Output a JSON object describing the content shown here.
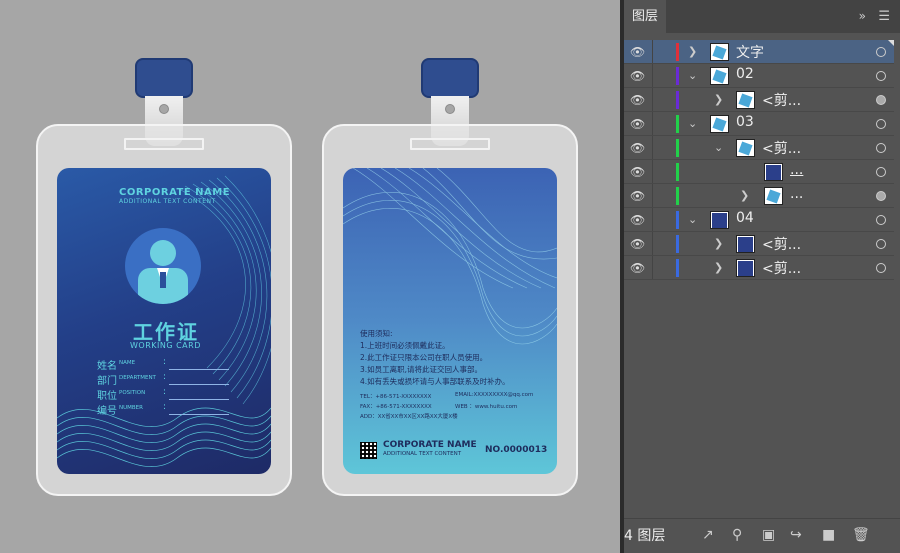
{
  "front_card": {
    "corp_name": "CORPORATE NAME",
    "corp_sub": "ADDITIONAL TEXT CONTENT",
    "title": "工作证",
    "title_en": "WORKING CARD",
    "fields": [
      {
        "cn": "姓名",
        "en": "NAME"
      },
      {
        "cn": "部门",
        "en": "DEPARTMENT"
      },
      {
        "cn": "职位",
        "en": "POSITION"
      },
      {
        "cn": "编号",
        "en": "NUMBER"
      }
    ],
    "colon": ":"
  },
  "back_card": {
    "notes_title": "使用须知:",
    "notes": [
      "1.上班时间必须佩戴此证。",
      "2.此工作证只限本公司在职人员使用。",
      "3.如员工离职,请将此证交回人事部。",
      "4.如有丢失或损坏请与人事部联系及时补办。"
    ],
    "tel": "TEL：+86-571-XXXXXXXX",
    "email": "EMAIL:XXXXXXXXX@qq.com",
    "fax": "FAX：+86-571-XXXXXXXX",
    "web": "WEB ：www.huitu.com",
    "add": "ADD：XX省XX市XX区XX路XX大厦X楼",
    "corp_name": "CORPORATE NAME",
    "corp_sub": "ADDITIONAL TEXT CONTENT",
    "number": "NO.0000013"
  },
  "layers_panel": {
    "tab": "图层",
    "collapse_icon": "double-chevron-icon",
    "menu_icon": "hamburger-icon",
    "count_label": "4 图层",
    "rows": [
      {
        "name": "文字",
        "color": "#e0303a"
      },
      {
        "name": "02",
        "color": "#6a2bd6"
      },
      {
        "name": "<剪...",
        "color": "#6a2bd6"
      },
      {
        "name": "03",
        "color": "#22d04a"
      },
      {
        "name": "<剪...",
        "color": "#22d04a"
      },
      {
        "name": "...",
        "color": "#22d04a"
      },
      {
        "name": "...",
        "color": "#22d04a"
      },
      {
        "name": "04",
        "color": "#3a6ae0"
      },
      {
        "name": "<剪...",
        "color": "#3a6ae0"
      },
      {
        "name": "<剪...",
        "color": "#3a6ae0"
      }
    ]
  }
}
